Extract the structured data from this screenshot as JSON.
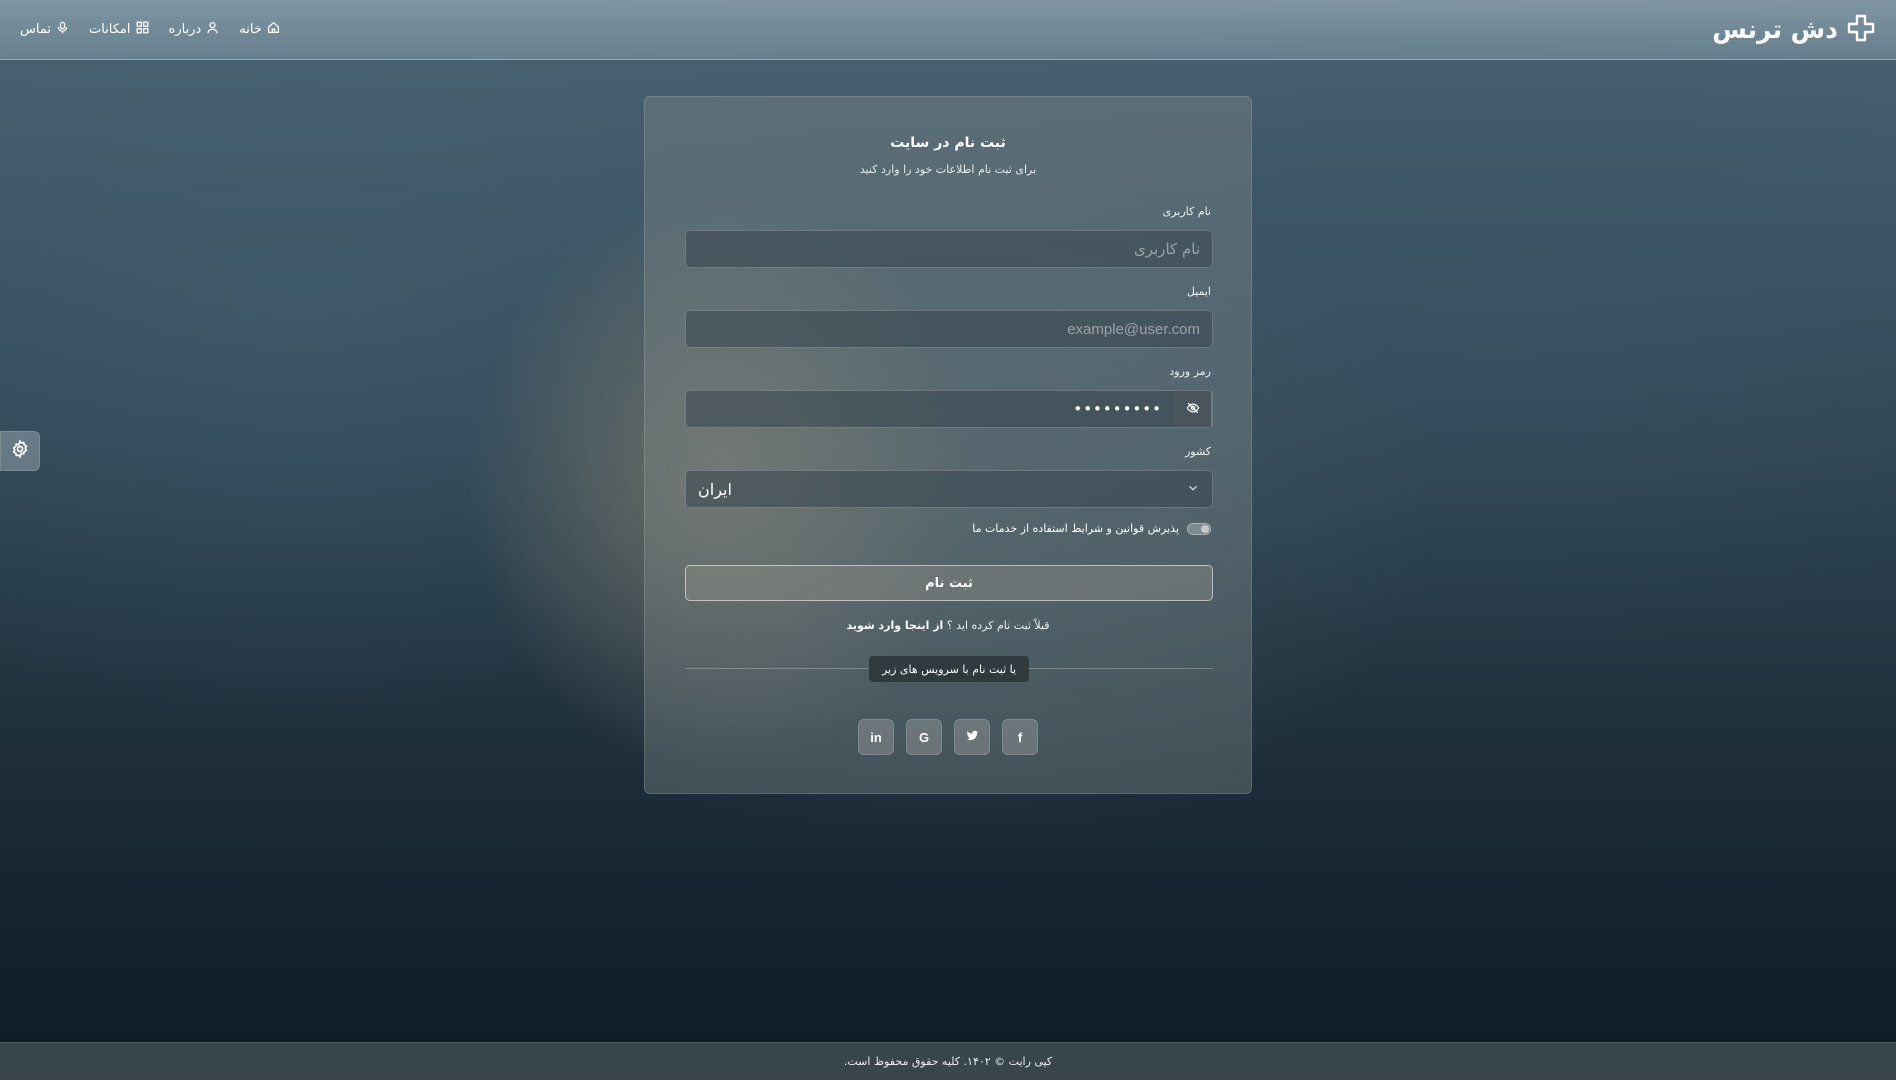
{
  "brand": {
    "name": "دش ترنس",
    "logo_icon": "plus-cross-logo-icon"
  },
  "nav": {
    "items": [
      {
        "label": "خانه",
        "icon": "home-icon"
      },
      {
        "label": "درباره",
        "icon": "user-icon"
      },
      {
        "label": "امکانات",
        "icon": "grid-icon"
      },
      {
        "label": "تماس",
        "icon": "microphone-icon"
      }
    ]
  },
  "settings": {
    "icon": "gear-icon"
  },
  "form": {
    "title": "ثبت نام در سایت",
    "subtitle": "برای ثبت نام اطلاعات خود را وارد کنید",
    "username": {
      "label": "نام کاربری",
      "placeholder": "نام کاربری",
      "value": ""
    },
    "email": {
      "label": "ایمیل",
      "placeholder": "example@user.com",
      "value": ""
    },
    "password": {
      "label": "رمز ورود",
      "value": "•••••••••",
      "toggle_icon": "eye-slash-icon"
    },
    "country": {
      "label": "کشور",
      "value": "ایران",
      "icon": "chevron-down-icon"
    },
    "terms_label": "پذیرش قوانین و شرایط استفاده از خدمات ما",
    "terms_checked": false,
    "submit_label": "ثبت نام",
    "login_prompt": "قبلاً ثبت نام کرده اید ؟",
    "login_link": "از اینجا وارد شوید",
    "divider_label": "یا ثبت نام با سرویس های زیر",
    "socials": [
      {
        "name": "linkedin",
        "glyph": "in"
      },
      {
        "name": "google",
        "glyph": "G"
      },
      {
        "name": "twitter",
        "glyph": ""
      },
      {
        "name": "facebook",
        "glyph": "f"
      }
    ]
  },
  "footer": {
    "text": "کپی رایت © ۱۴۰۲. کلیه حقوق محفوظ است."
  },
  "colors": {
    "card_bg": "#7f8a8a",
    "navbar_bg": "#9fb4bf",
    "footer_bg": "#3c484e",
    "accent_text": "#ffffff"
  }
}
